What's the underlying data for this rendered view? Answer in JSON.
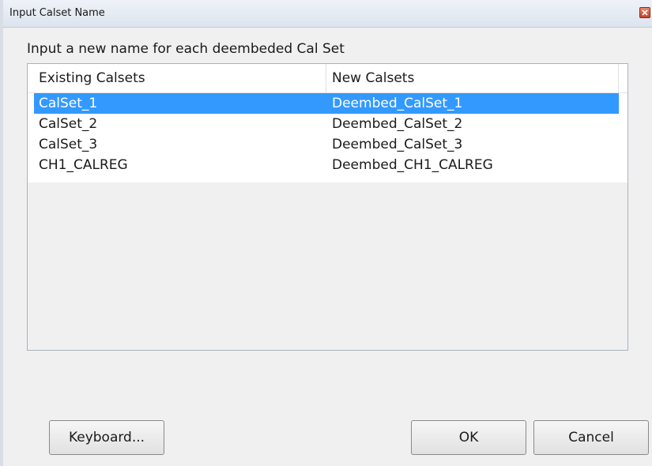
{
  "window": {
    "title": "Input Calset Name"
  },
  "instruction": "Input a new name for each deembeded Cal Set",
  "table": {
    "columns": [
      "Existing Calsets",
      "New Calsets"
    ],
    "rows": [
      {
        "existing": "CalSet_1",
        "new": "Deembed_CalSet_1",
        "selected": true
      },
      {
        "existing": "CalSet_2",
        "new": "Deembed_CalSet_2",
        "selected": false
      },
      {
        "existing": "CalSet_3",
        "new": "Deembed_CalSet_3",
        "selected": false
      },
      {
        "existing": "CH1_CALREG",
        "new": "Deembed_CH1_CALREG",
        "selected": false
      }
    ]
  },
  "buttons": {
    "keyboard": "Keyboard...",
    "ok": "OK",
    "cancel": "Cancel"
  },
  "colors": {
    "selection": "#3399ff",
    "close": "#c0442a"
  },
  "icons": {
    "close": "close-icon"
  }
}
